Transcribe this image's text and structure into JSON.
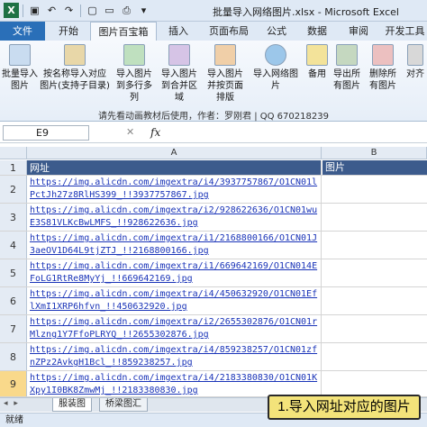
{
  "window": {
    "title": "批量导入网络图片.xlsx - Microsoft Excel"
  },
  "tabs": [
    {
      "label": "文件"
    },
    {
      "label": "开始"
    },
    {
      "label": "图片百宝箱"
    },
    {
      "label": "插入"
    },
    {
      "label": "页面布局"
    },
    {
      "label": "公式"
    },
    {
      "label": "数据"
    },
    {
      "label": "审阅"
    },
    {
      "label": "开发工具"
    }
  ],
  "ribbon": {
    "buttons": [
      {
        "label": "批量导入图片"
      },
      {
        "label": "按名称导入对应图片(支持子目录)"
      },
      {
        "label": "导入图片到多行多列"
      },
      {
        "label": "导入图片到合并区域"
      },
      {
        "label": "导入图片并按页面排版"
      },
      {
        "label": "导入网络图片"
      },
      {
        "label": "备用"
      },
      {
        "label": "导出所有图片"
      },
      {
        "label": "删除所有图片"
      },
      {
        "label": "对齐"
      }
    ],
    "note": "请先看动画教材后使用，作者：罗刚君 | QQ 670218239"
  },
  "formula_bar": {
    "name_box": "E9",
    "fx": "fx",
    "cancel": "✕"
  },
  "grid": {
    "columns": [
      "A",
      "B"
    ],
    "header_row": {
      "num": "1",
      "a": "网址",
      "b": "图片"
    },
    "rows": [
      {
        "num": "2",
        "url": "https://img.alicdn.com/imgextra/i4/3937757867/O1CN01lPctJh27z8RlHS399_!!3937757867.jpg"
      },
      {
        "num": "3",
        "url": "https://img.alicdn.com/imgextra/i2/928622636/O1CN01wuE3S81VLKcBwLMFS_!!928622636.jpg"
      },
      {
        "num": "4",
        "url": "https://img.alicdn.com/imgextra/i1/2168800166/O1CN01J3aeOV1D64L9tjZTJ_!!2168800166.jpg"
      },
      {
        "num": "5",
        "url": "https://img.alicdn.com/imgextra/i1/669642169/O1CN014EFoLG1RtRe8MyYj_!!669642169.jpg"
      },
      {
        "num": "6",
        "url": "https://img.alicdn.com/imgextra/i4/450632920/O1CN01EflXmI1XRP6hfvn_!!450632920.jpg"
      },
      {
        "num": "7",
        "url": "https://img.alicdn.com/imgextra/i2/2655302876/O1CN01rMlzng1Y7FfoPLRYQ_!!2655302876.jpg"
      },
      {
        "num": "8",
        "url": "https://img.alicdn.com/imgextra/i4/859238257/O1CN01zfnZPz2AvkgH1Bcl_!!859238257.jpg"
      },
      {
        "num": "9",
        "url": "https://img.alicdn.com/imgextra/i4/2183380830/O1CN01KXpy1I0BK8ZmwMj_!!2183380830.jpg"
      }
    ]
  },
  "sheet_tabs": {
    "nav": "◂ ▸",
    "items": [
      {
        "label": "服装图"
      },
      {
        "label": "桥梁图汇"
      }
    ]
  },
  "status": {
    "text": "就绪"
  },
  "callout": {
    "text": "1.导入网址对应的图片"
  },
  "colors": {
    "header_fill": "#3c5b8c",
    "link": "#1a34b8",
    "callout_bg": "#f3e37a",
    "file_tab": "#2a6fb8"
  }
}
